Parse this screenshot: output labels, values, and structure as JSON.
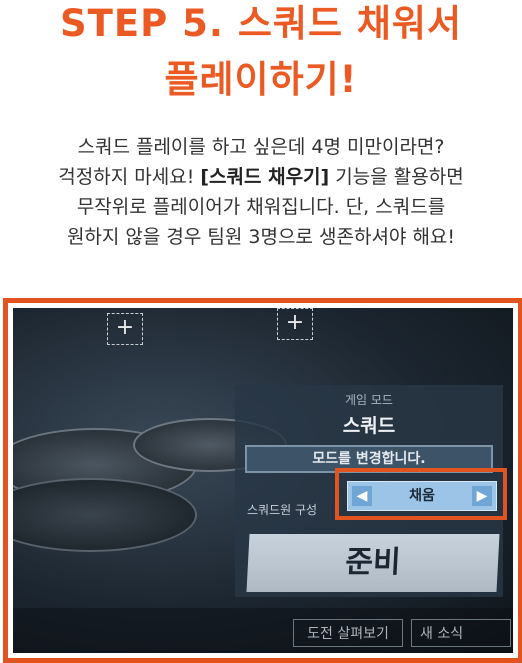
{
  "header": {
    "title_line1": "STEP 5. 스쿼드 채워서",
    "title_line2": "플레이하기!"
  },
  "description": {
    "part1": "스쿼드 플레이를 하고 싶은데 4명 미만이라면?",
    "part2": "걱정하지 마세요! ",
    "highlight": "[스쿼드 채우기]",
    "part3": " 기능을 활용하면",
    "part4": "무작위로 플레이어가 채워집니다. 단, 스쿼드를",
    "part5": "원하지 않을 경우 팀원 3명으로 생존하셔야 해요!"
  },
  "game_ui": {
    "slot_icon": "+",
    "mode_label": "게임 모드",
    "mode_value": "스쿼드",
    "change_mode_button": "모드를 변경합니다.",
    "squad_composition_label": "스쿼드원 구성",
    "squad_fill_value": "채움",
    "prev_arrow": "◀",
    "next_arrow": "▶",
    "ready_button": "준비",
    "challenge_button": "도전 살펴보기",
    "news_button": "새 소식"
  },
  "colors": {
    "accent": "#ec5a24",
    "highlight_border": "#e2541f",
    "selector_bg": "#9cc4e6"
  }
}
